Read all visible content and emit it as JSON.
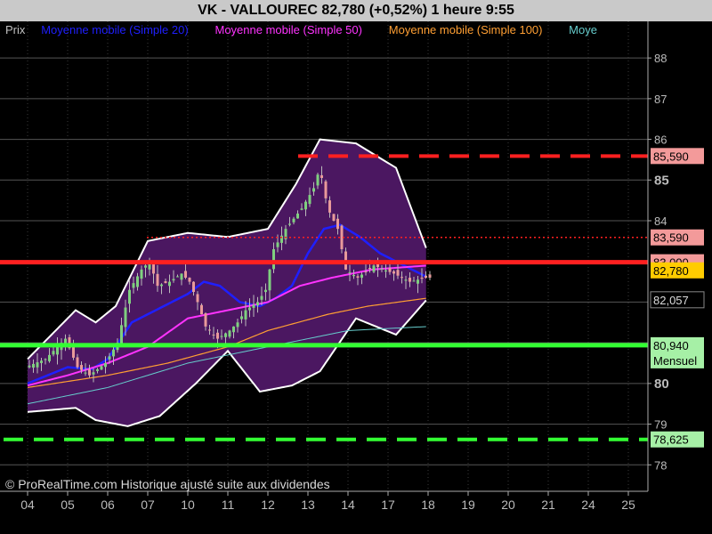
{
  "header": {
    "title": "VK - VALLOUREC    82,780 (+0,52%)    1 heure  9:55"
  },
  "watermark": "© ProRealTime.com Historique ajusté suite aux dividendes",
  "colors": {
    "background": "#000000",
    "bollinger_fill": "#4b1761",
    "ma20": "#1f1fff",
    "ma50": "#ff33ff",
    "ma100": "#ff9f33",
    "ma200": "#66cccc",
    "resistance": "#ff2020",
    "support": "#33ff33"
  },
  "chart_data": {
    "type": "candlestick",
    "title": "VK - VALLOUREC    82,780 (+0,52%)    1 heure  9:55",
    "legend": [
      {
        "label": "Prix",
        "color": "#c0c0c0"
      },
      {
        "label": "Moyenne mobile (Simple 20)",
        "color": "#1f1fff"
      },
      {
        "label": "Moyenne mobile (Simple 50)",
        "color": "#ff33ff"
      },
      {
        "label": "Moyenne mobile (Simple 100)",
        "color": "#ff9f33"
      },
      {
        "label": "Moye",
        "color": "#66cccc"
      }
    ],
    "x_ticks": [
      "04",
      "05",
      "06",
      "07",
      "10",
      "11",
      "12",
      "13",
      "14",
      "17",
      "18",
      "19",
      "20",
      "21",
      "24",
      "25"
    ],
    "y_ticks": [
      78,
      79,
      80,
      81,
      82,
      83,
      84,
      85,
      86,
      87,
      88
    ],
    "y_tick_labels": [
      "78",
      "79",
      "80",
      "",
      "",
      "",
      "84",
      "85",
      "86",
      "87",
      "88"
    ],
    "ylim": [
      77.35,
      88.9
    ],
    "grid": true,
    "horizontal_lines": [
      {
        "value": 85.59,
        "label": "85,590",
        "style": "dashed",
        "color": "#ff2020"
      },
      {
        "value": 83.59,
        "label": "83,590",
        "style": "dotted",
        "color": "#ff2020"
      },
      {
        "value": 82.98,
        "label": "83,000",
        "style": "solid",
        "color": "#ff2020"
      },
      {
        "value": 80.94,
        "label": "80,940",
        "style": "solid",
        "color": "#33ff33"
      },
      {
        "value": 78.625,
        "label": "78,625",
        "style": "dashed",
        "color": "#33ff33"
      }
    ],
    "price_tags": [
      {
        "value": 82.78,
        "label": "82,780"
      },
      {
        "value": 82.057,
        "label": "82,057"
      },
      {
        "value": 81.0,
        "label": "Mensuel"
      }
    ],
    "series": [
      {
        "name": "Prix",
        "anchors": [
          [
            0,
            80.4
          ],
          [
            0.5,
            80.6
          ],
          [
            1,
            81.1
          ],
          [
            1.3,
            80.4
          ],
          [
            1.6,
            80.2
          ],
          [
            2,
            80.5
          ],
          [
            2.3,
            81.0
          ],
          [
            2.6,
            82.3
          ],
          [
            2.9,
            82.8
          ],
          [
            3.1,
            83.0
          ],
          [
            3.3,
            82.4
          ],
          [
            3.6,
            82.5
          ],
          [
            3.9,
            82.7
          ],
          [
            4.1,
            82.5
          ],
          [
            4.3,
            82.0
          ],
          [
            4.5,
            81.4
          ],
          [
            4.8,
            81.1
          ],
          [
            5.1,
            81.3
          ],
          [
            5.3,
            81.5
          ],
          [
            5.5,
            81.8
          ],
          [
            5.8,
            82.0
          ],
          [
            6,
            82.3
          ],
          [
            6.2,
            83.3
          ],
          [
            6.5,
            83.8
          ],
          [
            6.9,
            84.3
          ],
          [
            7.2,
            84.8
          ],
          [
            7.35,
            85.3
          ],
          [
            7.55,
            84.3
          ],
          [
            7.8,
            83.8
          ],
          [
            8.0,
            82.8
          ],
          [
            8.3,
            82.6
          ],
          [
            8.7,
            82.9
          ],
          [
            9.2,
            82.7
          ],
          [
            9.6,
            82.5
          ],
          [
            10,
            82.6
          ]
        ]
      },
      {
        "name": "Moyenne mobile (Simple 20)",
        "anchors": [
          [
            0,
            80.0
          ],
          [
            1,
            80.4
          ],
          [
            1.6,
            80.35
          ],
          [
            2,
            80.6
          ],
          [
            2.6,
            81.5
          ],
          [
            3.4,
            81.9
          ],
          [
            4,
            82.2
          ],
          [
            4.4,
            82.5
          ],
          [
            4.8,
            82.4
          ],
          [
            5.3,
            82.0
          ],
          [
            5.8,
            81.9
          ],
          [
            6.2,
            82.1
          ],
          [
            6.6,
            82.4
          ],
          [
            7,
            83.2
          ],
          [
            7.4,
            83.8
          ],
          [
            7.8,
            83.9
          ],
          [
            8.3,
            83.6
          ],
          [
            8.8,
            83.2
          ],
          [
            9.2,
            83.0
          ],
          [
            9.6,
            82.8
          ],
          [
            10,
            82.6
          ]
        ]
      },
      {
        "name": "Moyenne mobile (Simple 50)",
        "anchors": [
          [
            0,
            79.95
          ],
          [
            1,
            80.2
          ],
          [
            2,
            80.5
          ],
          [
            3,
            80.9
          ],
          [
            4,
            81.6
          ],
          [
            5,
            81.8
          ],
          [
            6,
            82.0
          ],
          [
            6.8,
            82.4
          ],
          [
            7.6,
            82.6
          ],
          [
            8.6,
            82.8
          ],
          [
            10,
            82.9
          ]
        ]
      },
      {
        "name": "Moyenne mobile (Simple 100)",
        "anchors": [
          [
            0,
            79.9
          ],
          [
            2,
            80.2
          ],
          [
            3.5,
            80.5
          ],
          [
            5,
            80.9
          ],
          [
            6,
            81.3
          ],
          [
            7.5,
            81.7
          ],
          [
            8.5,
            81.9
          ],
          [
            10,
            82.1
          ]
        ]
      },
      {
        "name": "Moye",
        "anchors": [
          [
            0,
            79.5
          ],
          [
            2,
            79.9
          ],
          [
            4,
            80.5
          ],
          [
            6,
            80.9
          ],
          [
            8,
            81.3
          ],
          [
            10,
            81.4
          ]
        ]
      },
      {
        "name": "bollinger_upper",
        "anchors": [
          [
            0,
            80.6
          ],
          [
            1.2,
            81.8
          ],
          [
            1.7,
            81.5
          ],
          [
            2.2,
            81.9
          ],
          [
            3,
            83.5
          ],
          [
            4,
            83.7
          ],
          [
            5,
            83.6
          ],
          [
            6,
            83.8
          ],
          [
            6.7,
            84.9
          ],
          [
            7.3,
            86.0
          ],
          [
            8.2,
            85.9
          ],
          [
            9.2,
            85.3
          ],
          [
            10,
            83.2
          ]
        ]
      },
      {
        "name": "bollinger_lower",
        "anchors": [
          [
            0,
            79.3
          ],
          [
            1.2,
            79.4
          ],
          [
            1.7,
            79.1
          ],
          [
            2.5,
            78.95
          ],
          [
            3.3,
            79.2
          ],
          [
            4.2,
            80.0
          ],
          [
            5,
            80.8
          ],
          [
            5.8,
            79.8
          ],
          [
            6.6,
            79.95
          ],
          [
            7.3,
            80.3
          ],
          [
            8.2,
            81.6
          ],
          [
            9.2,
            81.2
          ],
          [
            10,
            82.1
          ]
        ]
      }
    ]
  }
}
